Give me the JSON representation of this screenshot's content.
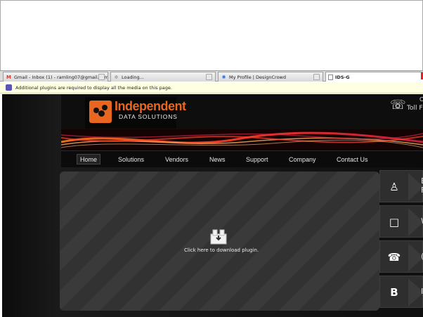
{
  "browser": {
    "tabs": [
      {
        "label": "Gmail - Inbox (1) - ramling07@gmail.com",
        "icon": "gmail-icon"
      },
      {
        "label": "Loading...",
        "icon": "loading-icon"
      },
      {
        "label": "My Profile | DesignCrowd",
        "icon": "designcrowd-icon"
      },
      {
        "label": "IDS-G",
        "icon": "page-icon",
        "active": true
      }
    ],
    "notification": "Additional plugins are required to display all the media on this page."
  },
  "site": {
    "logo": {
      "title": "Independent",
      "subtitle": "DATA SOLUTIONS"
    },
    "contact": {
      "line1": "C",
      "line2": "Toll F"
    },
    "nav": [
      "Home",
      "Solutions",
      "Vendors",
      "News",
      "Support",
      "Company",
      "Contact Us"
    ],
    "plugin": {
      "message": "Click here to download plugin."
    },
    "side_buttons": [
      {
        "icon": "person-icon",
        "label_line1": "E",
        "label_line2": "F"
      },
      {
        "icon": "document-icon",
        "label_line1": "W",
        "label_line2": ""
      },
      {
        "icon": "phone-icon",
        "label_line1": "(",
        "label_line2": ""
      },
      {
        "icon": "blogger-icon",
        "label_line1": "I",
        "label_line2": ""
      }
    ]
  },
  "colors": {
    "brand_orange": "#e8661f",
    "notify_bg": "#ffffe1"
  }
}
